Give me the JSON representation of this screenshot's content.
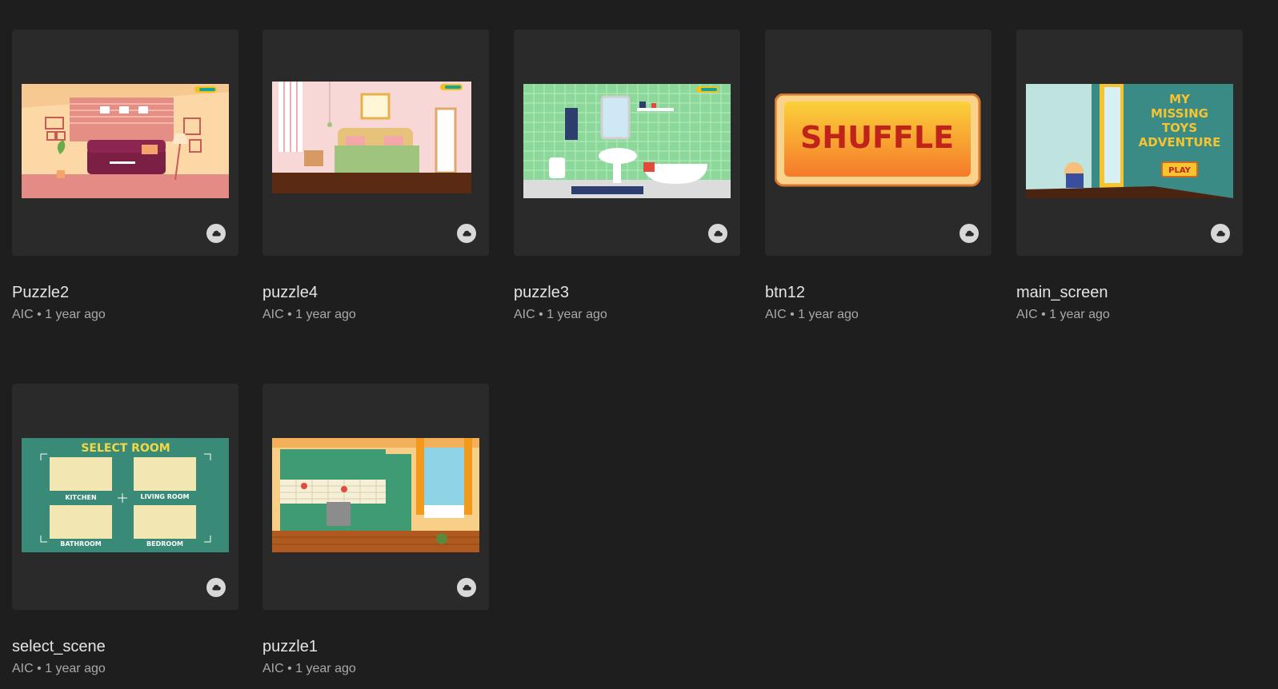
{
  "cards": [
    {
      "title": "Puzzle2",
      "meta": "AIC • 1 year ago",
      "thumb": "living-room"
    },
    {
      "title": "puzzle4",
      "meta": "AIC • 1 year ago",
      "thumb": "bedroom"
    },
    {
      "title": "puzzle3",
      "meta": "AIC • 1 year ago",
      "thumb": "bathroom"
    },
    {
      "title": "btn12",
      "meta": "AIC • 1 year ago",
      "thumb": "shuffle-button",
      "thumb_text": "SHUFFLE"
    },
    {
      "title": "main_screen",
      "meta": "AIC • 1 year ago",
      "thumb": "title-screen",
      "thumb_text": [
        "MY",
        "MISSING",
        "TOYS",
        "ADVENTURE"
      ],
      "play_label": "PLAY"
    },
    {
      "title": "select_scene",
      "meta": "AIC • 1 year ago",
      "thumb": "select-room",
      "thumb_text": "SELECT ROOM",
      "room_labels": [
        "KITCHEN",
        "LIVING ROOM",
        "BATHROOM",
        "BEDROOM"
      ]
    },
    {
      "title": "puzzle1",
      "meta": "AIC • 1 year ago",
      "thumb": "kitchen"
    }
  ],
  "icons": {
    "sync": "cloud-icon"
  },
  "colors": {
    "background": "#1e1e1e",
    "card": "#2a2a2a"
  }
}
